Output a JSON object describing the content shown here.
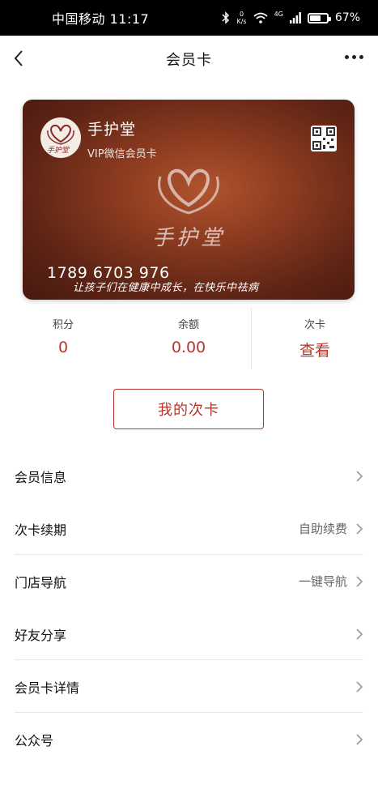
{
  "status_bar": {
    "carrier_time": "中国移动 11:17",
    "net_speed_value": "0",
    "net_speed_unit": "K/s",
    "network_type": "4G",
    "battery": "67%",
    "battery_level": 0.67
  },
  "header": {
    "title": "会员卡",
    "back_icon": "chevron-left-icon",
    "more_icon": "more-horizontal-icon"
  },
  "card": {
    "name": "手护堂",
    "subtitle": "VIP微信会员卡",
    "brand_text": "手护堂",
    "number": "1789 6703 976",
    "slogan": "让孩子们在健康中成长，在快乐中祛病",
    "logo_text": "手护堂",
    "qr_icon": "qr-code-icon"
  },
  "stats": {
    "points_label": "积分",
    "points_value": "0",
    "balance_label": "余额",
    "balance_value": "0.00",
    "count_card_label": "次卡",
    "count_card_action": "查看"
  },
  "my_card_button": "我的次卡",
  "menu": [
    {
      "label": "会员信息",
      "value": ""
    },
    {
      "label": "次卡续期",
      "value": "自助续费"
    },
    {
      "label": "门店导航",
      "value": "一键导航"
    },
    {
      "label": "好友分享",
      "value": ""
    },
    {
      "label": "会员卡详情",
      "value": ""
    },
    {
      "label": "公众号",
      "value": ""
    }
  ],
  "colors": {
    "accent": "#b3372f",
    "card_dark": "#47190f",
    "card_light": "#b0542f"
  }
}
